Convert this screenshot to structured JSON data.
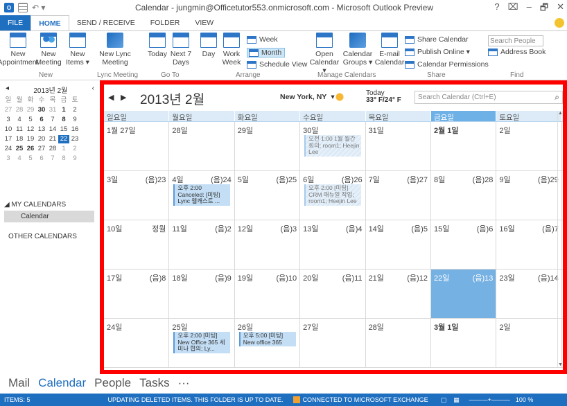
{
  "window": {
    "title": "Calendar - jungmin@Officetutor553.onmicrosoft.com - Microsoft Outlook Preview",
    "controls": [
      "?",
      "⌧",
      "–",
      "🗗",
      "✕"
    ]
  },
  "ribbon_tabs": [
    "FILE",
    "HOME",
    "SEND / RECEIVE",
    "FOLDER",
    "VIEW"
  ],
  "ribbon": {
    "new_appointment": "New Appointment",
    "new_meeting": "New Meeting",
    "new_items": "New Items ▾",
    "group_new": "New",
    "new_lync_meeting": "New Lync Meeting",
    "group_lync": "Lync Meeting",
    "today": "Today",
    "next7": "Next 7 Days",
    "group_goto": "Go To",
    "day": "Day",
    "work_week": "Work Week",
    "week": "Week",
    "month": "Month",
    "schedule_view": "Schedule View",
    "group_arrange": "Arrange",
    "open_calendar": "Open Calendar ▾",
    "calendar_groups": "Calendar Groups ▾",
    "group_manage": "Manage Calendars",
    "email_calendar": "E-mail Calendar",
    "share_calendar": "Share Calendar",
    "publish_online": "Publish Online ▾",
    "calendar_permissions": "Calendar Permissions",
    "group_share": "Share",
    "search_people": "Search People",
    "address_book": "Address Book",
    "group_find": "Find"
  },
  "mini_calendar": {
    "title": "2013년 2월",
    "prev": "◂",
    "next": "‹",
    "dow": [
      "일",
      "월",
      "화",
      "수",
      "목",
      "금",
      "토"
    ],
    "weeks": [
      [
        "27",
        "28",
        "29",
        "30",
        "31",
        "1",
        "2"
      ],
      [
        "3",
        "4",
        "5",
        "6",
        "7",
        "8",
        "9"
      ],
      [
        "10",
        "11",
        "12",
        "13",
        "14",
        "15",
        "16"
      ],
      [
        "17",
        "18",
        "19",
        "20",
        "21",
        "22",
        "23"
      ],
      [
        "24",
        "25",
        "26",
        "27",
        "28",
        "1",
        "2"
      ],
      [
        "3",
        "4",
        "5",
        "6",
        "7",
        "8",
        "9"
      ]
    ]
  },
  "nav": {
    "my_calendars": "◢ MY CALENDARS",
    "calendar_item": "Calendar",
    "other_calendars": "OTHER CALENDARS"
  },
  "calendar": {
    "title": "2013년 2월",
    "prev_arrow": "◀",
    "next_arrow": "▶",
    "city": "New York, NY",
    "weather_today_label": "Today",
    "weather_temp": "33° F/24° F",
    "search_placeholder": "Search Calendar (Ctrl+E)",
    "day_headers": [
      "일요일",
      "월요일",
      "화요일",
      "수요일",
      "목요일",
      "금요일",
      "토요일"
    ],
    "weeks": [
      [
        {
          "date": "1월 27일",
          "lunar": ""
        },
        {
          "date": "28일",
          "lunar": ""
        },
        {
          "date": "29일",
          "lunar": ""
        },
        {
          "date": "30일",
          "lunar": "",
          "event": {
            "text": "오전 1:00 1월 월간회의; room1; Heejin Lee",
            "style": "tent"
          }
        },
        {
          "date": "31일",
          "lunar": ""
        },
        {
          "date": "2월 1일",
          "lunar": "",
          "bold": true
        },
        {
          "date": "2일",
          "lunar": ""
        }
      ],
      [
        {
          "date": "3일",
          "lunar": "(음)23"
        },
        {
          "date": "4일",
          "lunar": "(음)24",
          "event": {
            "text": "오후 2:00 Canceled: [미팅] Lync 웹캐스트 ...",
            "style": "solid"
          }
        },
        {
          "date": "5일",
          "lunar": "(음)25"
        },
        {
          "date": "6일",
          "lunar": "(음)26",
          "event": {
            "text": "오후 2:00 [미팅] CRM 매뉴얼 작업; room1; Heejin Lee",
            "style": "tent"
          }
        },
        {
          "date": "7일",
          "lunar": "(음)27"
        },
        {
          "date": "8일",
          "lunar": "(음)28"
        },
        {
          "date": "9일",
          "lunar": "(음)29"
        }
      ],
      [
        {
          "date": "10일",
          "lunar": "정월"
        },
        {
          "date": "11일",
          "lunar": "(음)2"
        },
        {
          "date": "12일",
          "lunar": "(음)3"
        },
        {
          "date": "13일",
          "lunar": "(음)4"
        },
        {
          "date": "14일",
          "lunar": "(음)5"
        },
        {
          "date": "15일",
          "lunar": "(음)6"
        },
        {
          "date": "16일",
          "lunar": "(음)7"
        }
      ],
      [
        {
          "date": "17일",
          "lunar": "(음)8"
        },
        {
          "date": "18일",
          "lunar": "(음)9"
        },
        {
          "date": "19일",
          "lunar": "(음)10"
        },
        {
          "date": "20일",
          "lunar": "(음)11"
        },
        {
          "date": "21일",
          "lunar": "(음)12"
        },
        {
          "date": "22일",
          "lunar": "(음)13",
          "today": true
        },
        {
          "date": "23일",
          "lunar": "(음)14"
        }
      ],
      [
        {
          "date": "24일",
          "lunar": ""
        },
        {
          "date": "25일",
          "lunar": "",
          "event": {
            "text": "오후 2:00 [미팅] New Office 365 세미나 협의; Ly...",
            "style": "solid"
          }
        },
        {
          "date": "26일",
          "lunar": "",
          "event": {
            "text": "오후 5:00 [미팅] New office 365",
            "style": "solid"
          }
        },
        {
          "date": "27일",
          "lunar": ""
        },
        {
          "date": "28일",
          "lunar": ""
        },
        {
          "date": "3월 1일",
          "lunar": "",
          "bold": true
        },
        {
          "date": "2일",
          "lunar": ""
        }
      ]
    ]
  },
  "bottom_nav": [
    "Mail",
    "Calendar",
    "People",
    "Tasks",
    "···"
  ],
  "status": {
    "items": "ITEMS: 5",
    "updating": "UPDATING DELETED ITEMS.  THIS FOLDER IS UP TO DATE.",
    "connected": "CONNECTED TO MICROSOFT EXCHANGE",
    "zoom": "100 %"
  },
  "colors": {
    "accent": "#1f6fc0",
    "highlight_frame": "#ff0000",
    "today_cell": "#76b1e3"
  }
}
